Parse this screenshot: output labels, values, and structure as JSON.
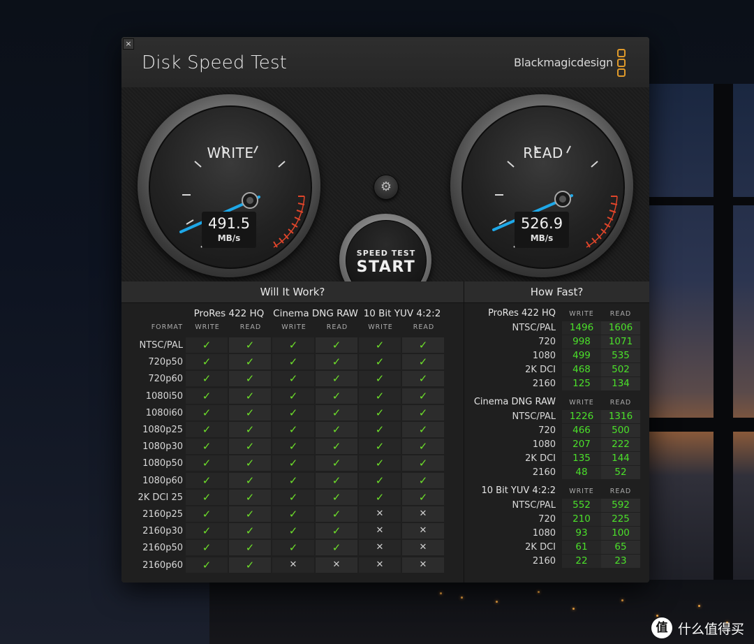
{
  "app": {
    "title": "Disk Speed Test",
    "brand": "Blackmagicdesign",
    "close_label": "×"
  },
  "gauges": {
    "write": {
      "label": "WRITE",
      "value": "491.5",
      "unit": "MB/s"
    },
    "read": {
      "label": "READ",
      "value": "526.9",
      "unit": "MB/s"
    }
  },
  "controls": {
    "settings_icon": "gear-icon",
    "start_top": "SPEED TEST",
    "start_main": "START"
  },
  "will_it_work": {
    "title": "Will It Work?",
    "format_header": "FORMAT",
    "write_header": "WRITE",
    "read_header": "READ",
    "groups": [
      "ProRes 422 HQ",
      "Cinema DNG RAW",
      "10 Bit YUV 4:2:2"
    ],
    "rows": [
      {
        "format": "NTSC/PAL",
        "results": [
          1,
          1,
          1,
          1,
          1,
          1
        ]
      },
      {
        "format": "720p50",
        "results": [
          1,
          1,
          1,
          1,
          1,
          1
        ]
      },
      {
        "format": "720p60",
        "results": [
          1,
          1,
          1,
          1,
          1,
          1
        ]
      },
      {
        "format": "1080i50",
        "results": [
          1,
          1,
          1,
          1,
          1,
          1
        ]
      },
      {
        "format": "1080i60",
        "results": [
          1,
          1,
          1,
          1,
          1,
          1
        ]
      },
      {
        "format": "1080p25",
        "results": [
          1,
          1,
          1,
          1,
          1,
          1
        ]
      },
      {
        "format": "1080p30",
        "results": [
          1,
          1,
          1,
          1,
          1,
          1
        ]
      },
      {
        "format": "1080p50",
        "results": [
          1,
          1,
          1,
          1,
          1,
          1
        ]
      },
      {
        "format": "1080p60",
        "results": [
          1,
          1,
          1,
          1,
          1,
          1
        ]
      },
      {
        "format": "2K DCI 25",
        "results": [
          1,
          1,
          1,
          1,
          1,
          1
        ]
      },
      {
        "format": "2160p25",
        "results": [
          1,
          1,
          1,
          1,
          0,
          0
        ]
      },
      {
        "format": "2160p30",
        "results": [
          1,
          1,
          1,
          1,
          0,
          0
        ]
      },
      {
        "format": "2160p50",
        "results": [
          1,
          1,
          1,
          1,
          0,
          0
        ]
      },
      {
        "format": "2160p60",
        "results": [
          1,
          1,
          0,
          0,
          0,
          0
        ]
      }
    ],
    "ok_glyph": "✓",
    "no_glyph": "✕"
  },
  "how_fast": {
    "title": "How Fast?",
    "write_header": "WRITE",
    "read_header": "READ",
    "sections": [
      {
        "name": "ProRes 422 HQ",
        "rows": [
          {
            "label": "NTSC/PAL",
            "write": "1496",
            "read": "1606"
          },
          {
            "label": "720",
            "write": "998",
            "read": "1071"
          },
          {
            "label": "1080",
            "write": "499",
            "read": "535"
          },
          {
            "label": "2K DCI",
            "write": "468",
            "read": "502"
          },
          {
            "label": "2160",
            "write": "125",
            "read": "134"
          }
        ]
      },
      {
        "name": "Cinema DNG RAW",
        "rows": [
          {
            "label": "NTSC/PAL",
            "write": "1226",
            "read": "1316"
          },
          {
            "label": "720",
            "write": "466",
            "read": "500"
          },
          {
            "label": "1080",
            "write": "207",
            "read": "222"
          },
          {
            "label": "2K DCI",
            "write": "135",
            "read": "144"
          },
          {
            "label": "2160",
            "write": "48",
            "read": "52"
          }
        ]
      },
      {
        "name": "10 Bit YUV 4:2:2",
        "rows": [
          {
            "label": "NTSC/PAL",
            "write": "552",
            "read": "592"
          },
          {
            "label": "720",
            "write": "210",
            "read": "225"
          },
          {
            "label": "1080",
            "write": "93",
            "read": "100"
          },
          {
            "label": "2K DCI",
            "write": "61",
            "read": "65"
          },
          {
            "label": "2160",
            "write": "22",
            "read": "23"
          }
        ]
      }
    ]
  },
  "watermark": {
    "icon": "值",
    "text": "什么值得买"
  },
  "colors": {
    "ok": "#6ee02a",
    "number": "#4be02a",
    "needle": "#1ea8e8",
    "redline": "#e0452a",
    "brand": "#e09a2a"
  }
}
